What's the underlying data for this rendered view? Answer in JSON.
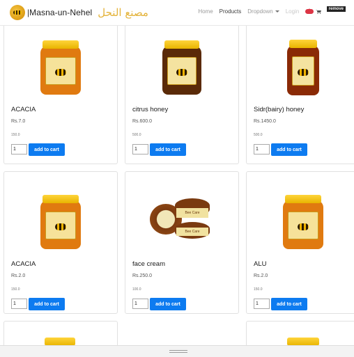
{
  "navbar": {
    "brand_separator": "|",
    "brand_name": "Masna-un-Nehel",
    "brand_arabic": "مصنع النحل",
    "links": [
      "Home",
      "Products",
      "Dropdown",
      "Login"
    ],
    "cart_count": "0",
    "remove_label": "remove"
  },
  "products": [
    {
      "name": "ACACIA",
      "price": "Rs.7.0",
      "weight": "150.0",
      "qty": "1",
      "button": "add to cart",
      "image": "honey-jar-orange"
    },
    {
      "name": "citrus honey",
      "price": "Rs.600.0",
      "weight": "500.0",
      "qty": "1",
      "button": "add to cart",
      "image": "honey-jar-dark"
    },
    {
      "name": "Sidr(bairy) honey",
      "price": "Rs.1450.0",
      "weight": "500.0",
      "qty": "1",
      "button": "add to cart",
      "image": "honey-jar-red"
    },
    {
      "name": "ACACIA",
      "price": "Rs.2.0",
      "weight": "150.0",
      "qty": "1",
      "button": "add to cart",
      "image": "honey-jar-orange"
    },
    {
      "name": "face cream",
      "price": "Rs.250.0",
      "weight": "100.0",
      "qty": "1",
      "button": "add to cart",
      "image": "cream-pots"
    },
    {
      "name": "ALU",
      "price": "Rs.2.0",
      "weight": "150.0",
      "qty": "1",
      "button": "add to cart",
      "image": "honey-jar-orange"
    }
  ],
  "colors": {
    "accent": "#0d7bf0",
    "brand": "#e4b33a",
    "badge": "#dc3545"
  }
}
